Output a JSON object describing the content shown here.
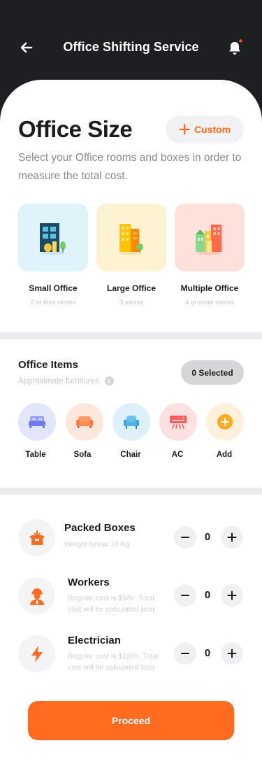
{
  "header": {
    "title": "Office Shifting Service"
  },
  "office_size": {
    "heading": "Office Size",
    "custom_label": "Custom",
    "description": "Select your Office rooms and boxes in order to measure the total cost.",
    "options": [
      {
        "label": "Small Office",
        "sub": "2 or less rooms",
        "bg": "#dff3fb"
      },
      {
        "label": "Large Office",
        "sub": "3 rooms",
        "bg": "#fdf3d3"
      },
      {
        "label": "Multiple Office",
        "sub": "4 or more rooms",
        "bg": "#fde1da"
      }
    ]
  },
  "office_items": {
    "title": "Office Items",
    "subtitle": "Approximate furnitures",
    "selected": "0 Selected",
    "items": [
      {
        "label": "Table",
        "icon": "bed-icon",
        "bg": "#e3e6fb"
      },
      {
        "label": "Sofa",
        "icon": "sofa-icon",
        "bg": "#fde7dc"
      },
      {
        "label": "Chair",
        "icon": "armchair-icon",
        "bg": "#def1fb"
      },
      {
        "label": "AC",
        "icon": "air-conditioner-icon",
        "bg": "#fde1e1"
      },
      {
        "label": "Add",
        "icon": "plus-icon",
        "bg": "#fdf0dd"
      }
    ]
  },
  "services": [
    {
      "title": "Packed Boxes",
      "sub": "Weight below 10 Kg",
      "count": "0",
      "icon": "box-icon"
    },
    {
      "title": "Workers",
      "sub": "Regular cost is $5/hr. Total cost will be calculated later",
      "count": "0",
      "icon": "worker-icon"
    },
    {
      "title": "Electrician",
      "sub": "Regular cost is $10/hr. Total cost will be calculated later",
      "count": "0",
      "icon": "lightning-icon"
    }
  ],
  "proceed_label": "Proceed",
  "colors": {
    "accent": "#ff6b1f",
    "dark": "#1e1f22"
  }
}
